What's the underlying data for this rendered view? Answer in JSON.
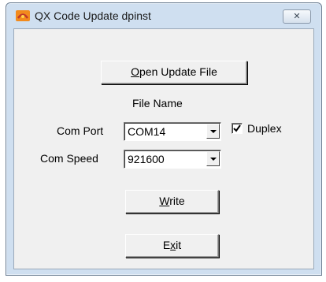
{
  "window": {
    "title": "QX Code Update dpinst",
    "icon": "app-logo-icon",
    "close_glyph": "✕"
  },
  "buttons": {
    "open_prefix": "",
    "open_mnemonic": "O",
    "open_rest": "pen Update File",
    "write_prefix": "",
    "write_mnemonic": "W",
    "write_rest": "rite",
    "exit_prefix": "E",
    "exit_mnemonic": "x",
    "exit_rest": "it"
  },
  "file_name_label": "File Name",
  "com_port": {
    "label": "Com Port",
    "value": "COM14"
  },
  "com_speed": {
    "label": "Com Speed",
    "value": "921600"
  },
  "duplex": {
    "label": "Duplex",
    "checked": true
  },
  "colors": {
    "frame": "#cfdff0",
    "client": "#f0f0f0",
    "icon_orange": "#f28a1c"
  }
}
